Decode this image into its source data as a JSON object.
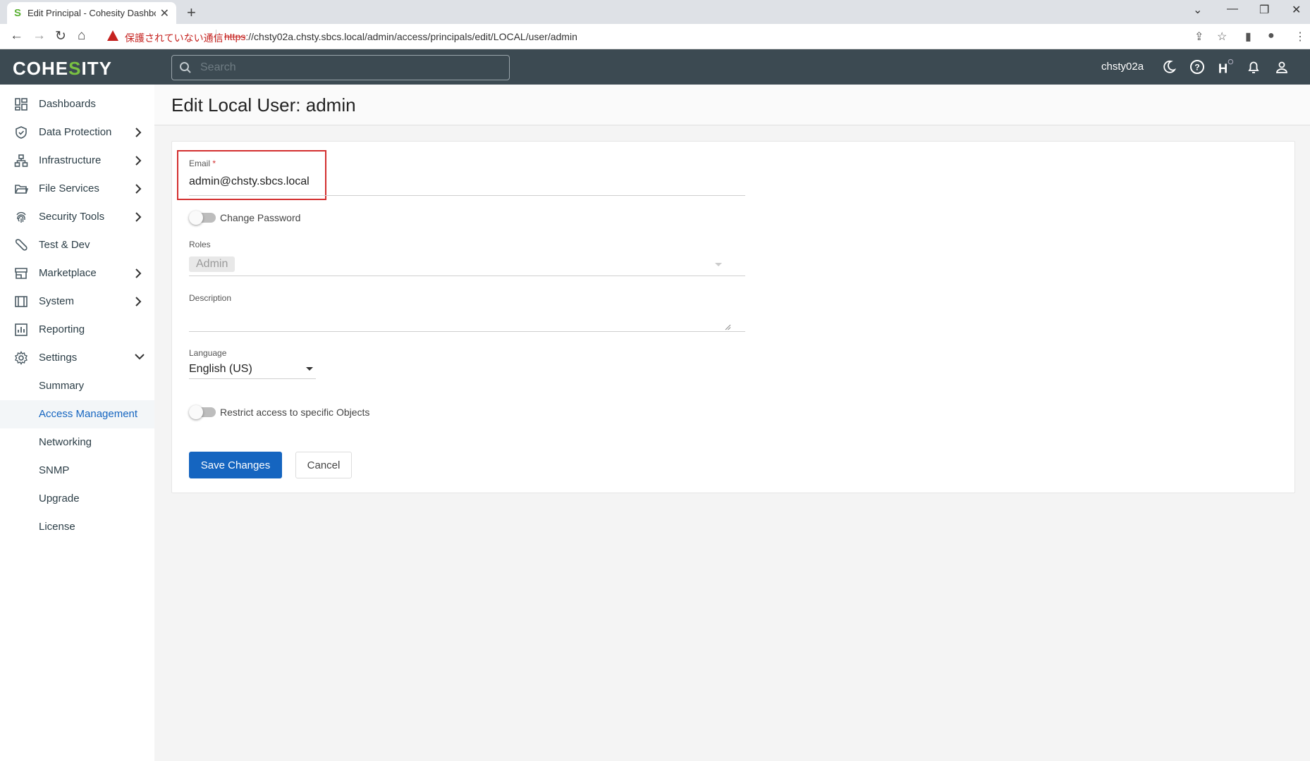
{
  "browser": {
    "tab_title": "Edit Principal - Cohesity Dashboa",
    "security_warning": "保護されていない通信",
    "url_scheme": "https",
    "url_rest": "://chsty02a.chsty.sbcs.local/admin/access/principals/edit/LOCAL/user/admin"
  },
  "header": {
    "logo_pre": "COHE",
    "logo_s": "S",
    "logo_post": "ITY",
    "search_placeholder": "Search",
    "cluster_name": "chsty02a"
  },
  "sidebar": {
    "items": [
      {
        "label": "Dashboards",
        "icon": "dashboard-icon"
      },
      {
        "label": "Data Protection",
        "icon": "shield-icon"
      },
      {
        "label": "Infrastructure",
        "icon": "infrastructure-icon"
      },
      {
        "label": "File Services",
        "icon": "folder-icon"
      },
      {
        "label": "Security Tools",
        "icon": "fingerprint-icon"
      },
      {
        "label": "Test & Dev",
        "icon": "wrench-icon"
      },
      {
        "label": "Marketplace",
        "icon": "store-icon"
      },
      {
        "label": "System",
        "icon": "system-icon"
      },
      {
        "label": "Reporting",
        "icon": "report-icon"
      },
      {
        "label": "Settings",
        "icon": "gear-icon"
      }
    ],
    "settings_sub": [
      "Summary",
      "Access Management",
      "Networking",
      "SNMP",
      "Upgrade",
      "License"
    ],
    "active": "Access Management"
  },
  "page": {
    "title": "Edit Local User: admin"
  },
  "form": {
    "email_label": "Email",
    "email_required": "*",
    "email_value": "admin@chsty.sbcs.local",
    "change_password_label": "Change Password",
    "roles_label": "Roles",
    "roles_value": "Admin",
    "description_label": "Description",
    "language_label": "Language",
    "language_value": "English (US)",
    "restrict_label": "Restrict access to specific Objects",
    "save_label": "Save Changes",
    "cancel_label": "Cancel"
  },
  "colors": {
    "header_bg": "#3c4a52",
    "accent": "#1565c0",
    "highlight_red": "#d32f2f",
    "brand_green": "#7ac142"
  }
}
